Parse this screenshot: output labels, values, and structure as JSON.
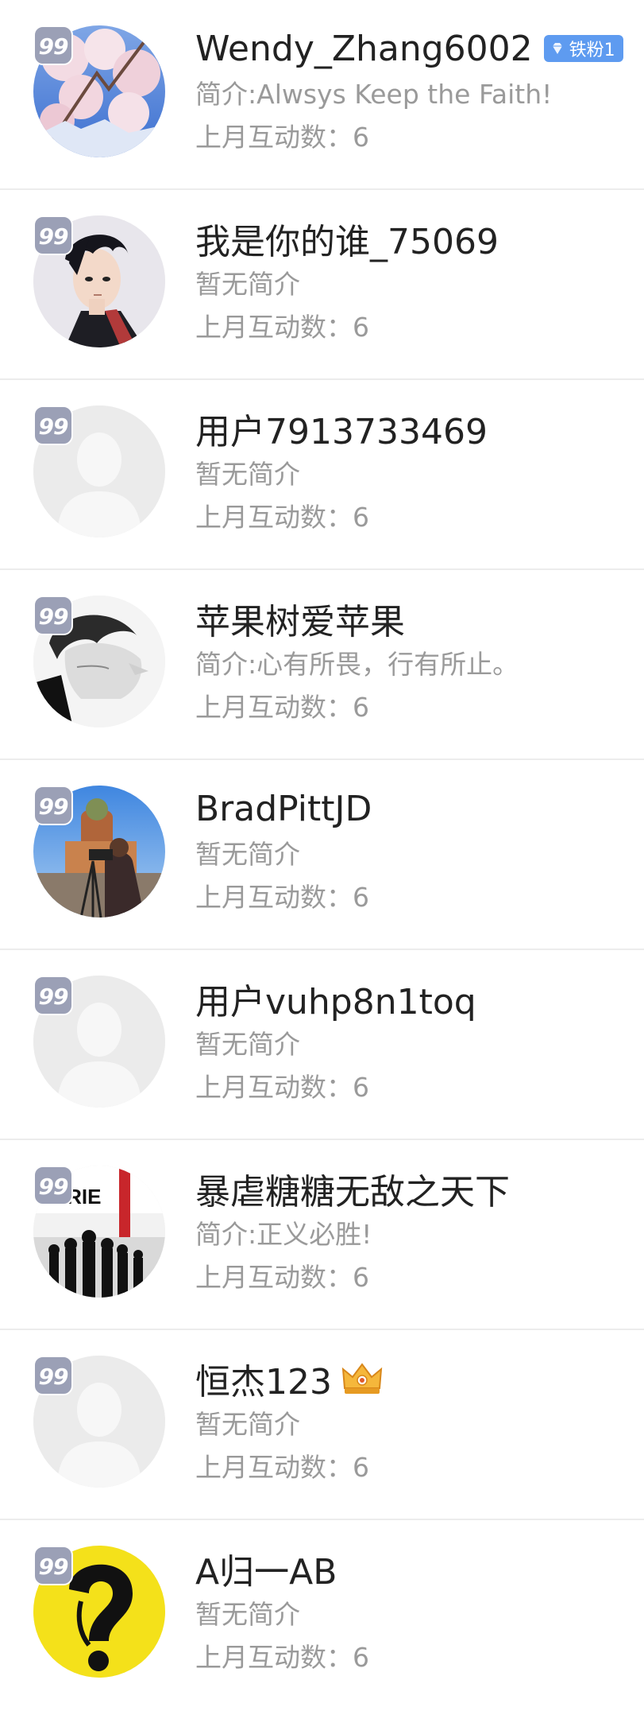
{
  "level_badge_text": "99",
  "stat_label": "上月互动数：",
  "users": [
    {
      "name": "Wendy_Zhang6002",
      "bio": "简介:Alwsys Keep the Faith!",
      "interactions": "6",
      "avatar": "cherry-blossom-photo",
      "badge": {
        "type": "fan",
        "label": "铁粉1",
        "color": "#5e9bf0"
      }
    },
    {
      "name": "我是你的谁_75069",
      "bio": "暂无简介",
      "interactions": "6",
      "avatar": "anime-boy-illustration"
    },
    {
      "name": "用户7913733469",
      "bio": "暂无简介",
      "interactions": "6",
      "avatar": "default-avatar"
    },
    {
      "name": "苹果树爱苹果",
      "bio": "简介:心有所畏，行有所止。",
      "interactions": "6",
      "avatar": "sketch-portrait"
    },
    {
      "name": "BradPittJD",
      "bio": "暂无简介",
      "interactions": "6",
      "avatar": "photographer-cathedral-photo"
    },
    {
      "name": "用户vuhp8n1toq",
      "bio": "暂无简介",
      "interactions": "6",
      "avatar": "default-avatar"
    },
    {
      "name": "暴虐糖糖无敌之天下",
      "bio": "简介:正义必胜!",
      "interactions": "6",
      "avatar": "valkyrie-movie-poster",
      "avatar_text": "KYRIE"
    },
    {
      "name": "恒杰123",
      "bio": "暂无简介",
      "interactions": "6",
      "avatar": "default-avatar",
      "badge": {
        "type": "crown",
        "icon": "crown-icon",
        "color": "#f0a22c"
      }
    },
    {
      "name": "A归一AB",
      "bio": "暂无简介",
      "interactions": "6",
      "avatar": "yellow-question-mark-face"
    }
  ]
}
